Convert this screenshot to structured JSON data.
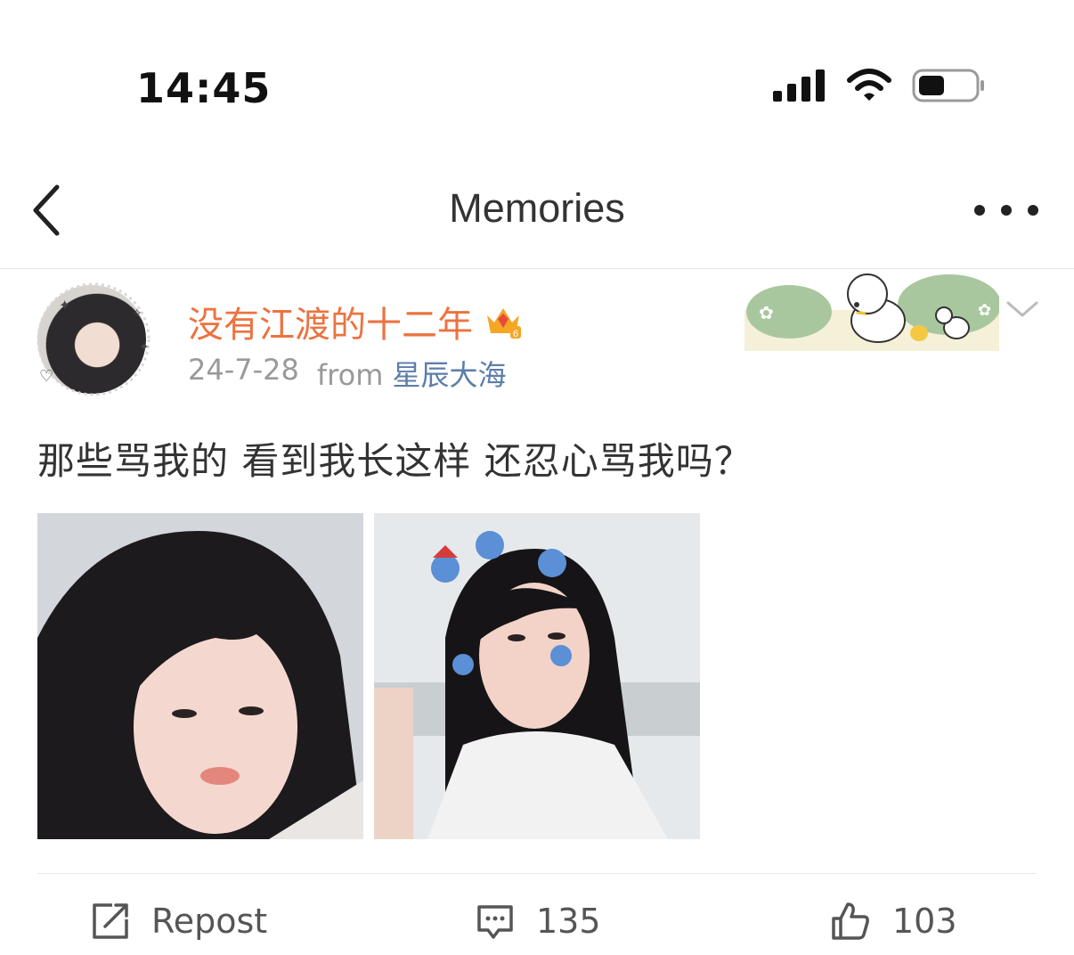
{
  "status_bar": {
    "time": "14:45",
    "icons": [
      "signal-icon",
      "wifi-icon",
      "battery-icon"
    ]
  },
  "nav": {
    "title": "Memories",
    "back_icon": "chevron-left-icon",
    "more_icon": "more-dots-icon"
  },
  "post": {
    "username": "没有江渡的十二年",
    "badge_icon": "vip-crown-icon",
    "date": "24-7-28",
    "from_label": "from",
    "source": "星辰大海",
    "text": "那些骂我的 看到我长这样 还忍心骂我吗？",
    "images": [
      "photo-1",
      "photo-2"
    ]
  },
  "actions": {
    "repost_label": "Repost",
    "comment_count": "135",
    "like_count": "103"
  },
  "colors": {
    "username": "#eb7340",
    "source_link": "#5d7ea8",
    "meta_text": "#999999"
  }
}
